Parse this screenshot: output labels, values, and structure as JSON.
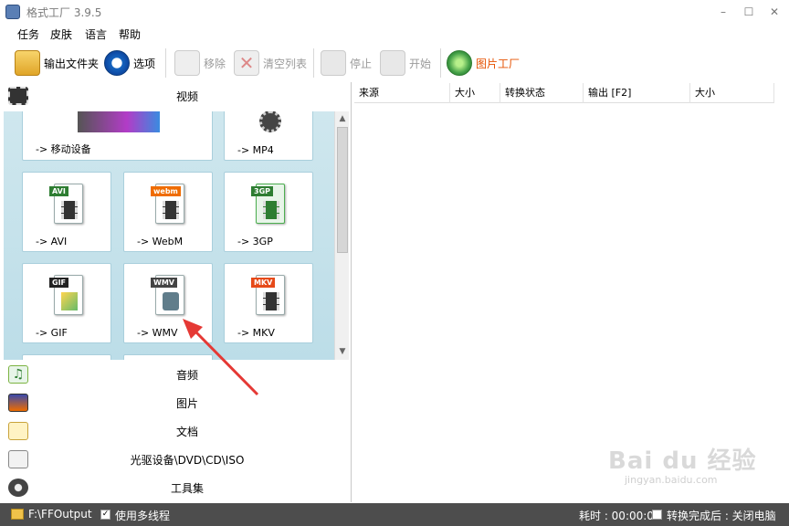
{
  "title": "格式工厂 3.9.5",
  "window_controls": {
    "minimize": "–",
    "maximize": "☐",
    "close": "✕"
  },
  "menu": [
    "任务",
    "皮肤",
    "语言",
    "帮助"
  ],
  "toolbar": {
    "output_folder": "输出文件夹",
    "options": "选项",
    "remove": "移除",
    "clear_list": "清空列表",
    "stop": "停止",
    "start": "开始",
    "picture_factory": "图片工厂"
  },
  "categories": {
    "video": "视频",
    "audio": "音频",
    "picture": "图片",
    "document": "文档",
    "optical": "光驱设备\\DVD\\CD\\ISO",
    "tools": "工具集"
  },
  "tiles": [
    {
      "label": "-> 移动设备"
    },
    {
      "label": "-> MP4"
    },
    {
      "label": "-> AVI",
      "tag": "AVI",
      "color": "#2e7d32"
    },
    {
      "label": "-> WebM",
      "tag": "webm",
      "color": "#ef6c00"
    },
    {
      "label": "-> 3GP",
      "tag": "3GP",
      "color": "#2e7d32"
    },
    {
      "label": "-> GIF",
      "tag": "GIF",
      "color": "#222"
    },
    {
      "label": "-> WMV",
      "tag": "WMV",
      "color": "#444"
    },
    {
      "label": "-> MKV",
      "tag": "MKV",
      "color": "#e64a19"
    }
  ],
  "columns": [
    "来源",
    "大小",
    "转换状态",
    "输出 [F2]",
    "大小"
  ],
  "status": {
    "output_path": "F:\\FFOutput",
    "multithread": "使用多线程",
    "elapsed": "耗时 : 00:00:00",
    "after_done": "转换完成后 : 关闭电脑"
  },
  "watermark": {
    "brand": "Bai du 经验",
    "url": "jingyan.baidu.com"
  }
}
